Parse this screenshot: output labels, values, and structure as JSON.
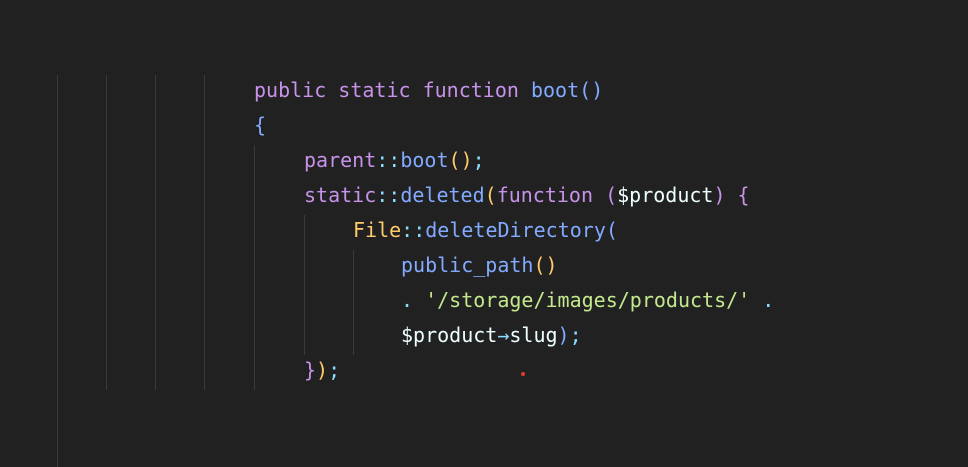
{
  "editor": {
    "theme_colors": {
      "background": "#212121",
      "keyword": "#c792ea",
      "function": "#82aaff",
      "class": "#ffcb6b",
      "string": "#c3e88d",
      "operator": "#89ddff",
      "variable": "#eeffff"
    },
    "lines": {
      "l1": {
        "kw1": "public",
        "kw2": "static",
        "kw3": "function",
        "fn": "boot",
        "open": "(",
        "close": ")"
      },
      "l2": {
        "brace": "{"
      },
      "l3": {
        "obj": "parent",
        "sep": "::",
        "fn": "boot",
        "open": "(",
        "close": ")",
        "end": ";"
      },
      "l4": {
        "obj": "static",
        "sep": "::",
        "fn": "deleted",
        "open": "(",
        "kw": "function",
        "p_open": "(",
        "var": "$product",
        "p_close": ")",
        "brace": "{"
      },
      "l5": {
        "cls": "File",
        "sep": "::",
        "fn": "deleteDirectory",
        "open": "("
      },
      "l6": {
        "fn": "public_path",
        "open": "(",
        "close": ")"
      },
      "l7": {
        "dot1": ".",
        "str": "'/storage/images/products/'",
        "dot2": "."
      },
      "l8": {
        "var": "$product",
        "arrow": "→",
        "prop": "slug",
        "close": ")",
        "end": ";"
      },
      "l9": {
        "brace": "}",
        "close": ")",
        "end": ";"
      }
    }
  }
}
